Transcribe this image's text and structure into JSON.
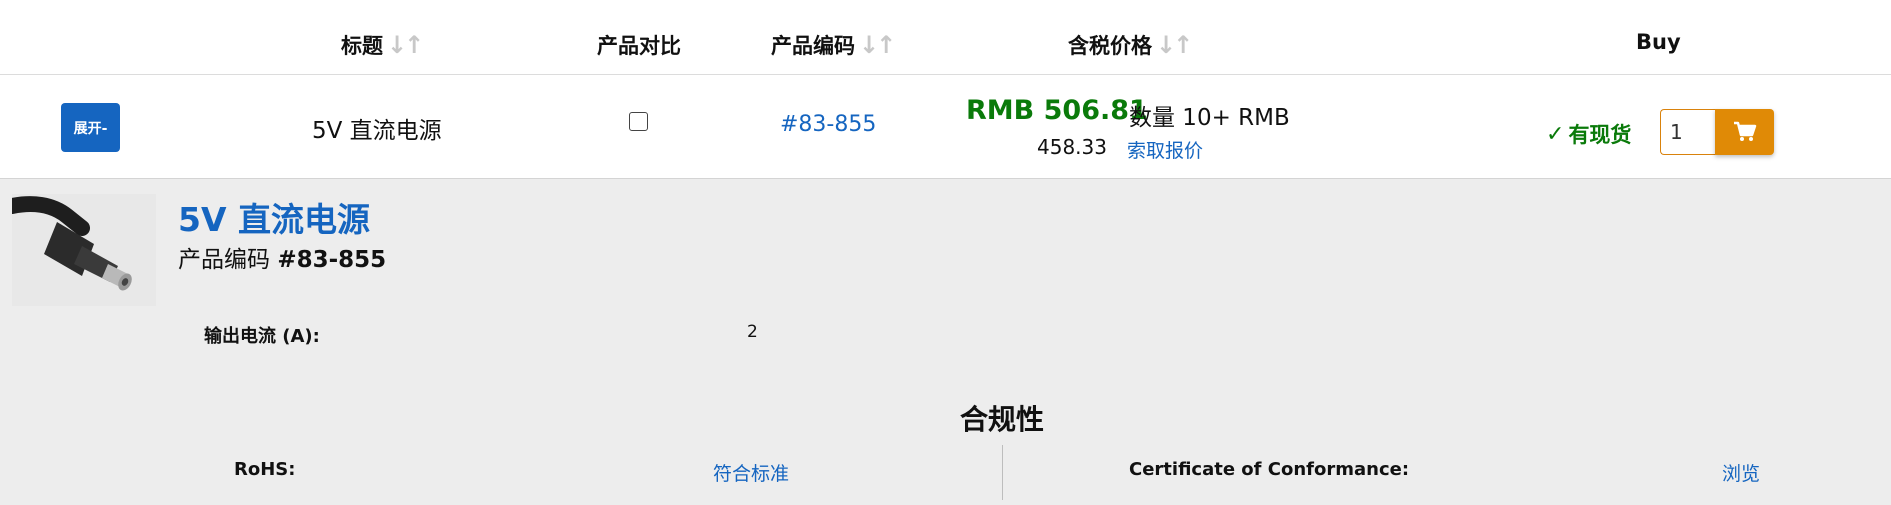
{
  "header": {
    "title_col": "标题",
    "compare_col": "产品对比",
    "code_col": "产品编码",
    "price_col": "含税价格",
    "buy_col": "Buy",
    "sort_icon": "sort-arrows-icon"
  },
  "product": {
    "expand_label": "展开-",
    "title": "5V 直流电源",
    "code": "#83-855",
    "price": "RMB 506.81",
    "qty_price_label": "数量 10+ RMB",
    "qty_price_value": "458.33",
    "quote_link": "索取报价",
    "stock_status": "有现货",
    "quantity": "1",
    "compare_checked": false
  },
  "details": {
    "title": "5V 直流电源",
    "code_label": "产品编码",
    "code_value": "#83-855",
    "specs": [
      {
        "label": "输出电流 (A):",
        "value": "2"
      }
    ],
    "compliance": {
      "heading": "合规性",
      "rohs_label": "RoHS:",
      "rohs_value": "符合标准",
      "coc_label": "Certificate of Conformance:",
      "coc_value": "浏览"
    }
  },
  "colors": {
    "accent_blue": "#1565c0",
    "price_green": "#0a7a0a",
    "cart_orange": "#e08a06",
    "panel_gray": "#ededed"
  }
}
